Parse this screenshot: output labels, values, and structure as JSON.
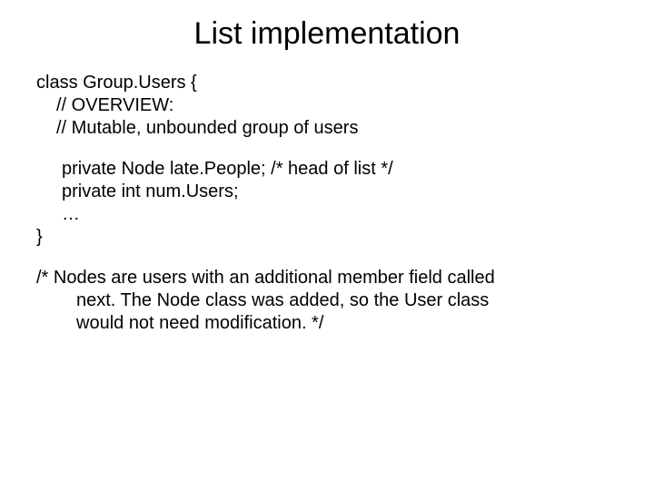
{
  "title": "List implementation",
  "code": {
    "line1": "class Group.Users {",
    "line2": "// OVERVIEW:",
    "line3": "// Mutable, unbounded group of users",
    "line4": "private Node late.People; /* head of list */",
    "line5": "private int num.Users;",
    "line6": "…",
    "line7": "}"
  },
  "note": {
    "l1": "/* Nodes are users with an additional member field called",
    "l2": "next.  The Node class was added, so the User class",
    "l3": "would not need modification. */"
  }
}
